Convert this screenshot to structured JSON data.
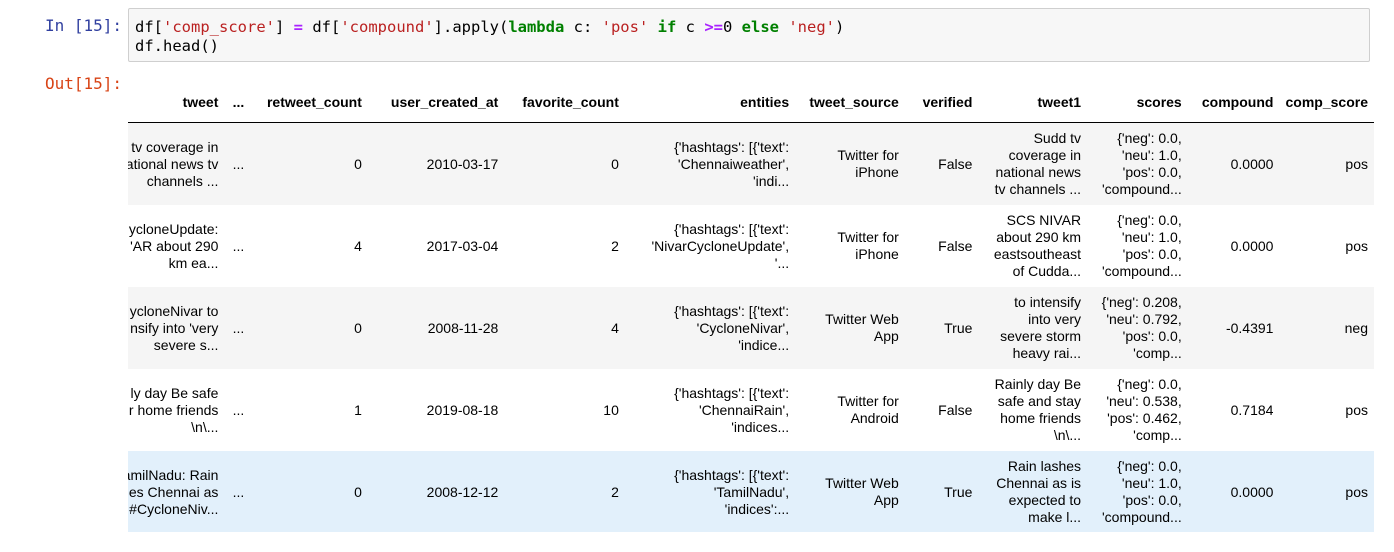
{
  "input": {
    "prompt": "In [15]:",
    "line1": [
      {
        "t": "df[",
        "c": ""
      },
      {
        "t": "'comp_score'",
        "c": "s"
      },
      {
        "t": "] ",
        "c": ""
      },
      {
        "t": "=",
        "c": "op"
      },
      {
        "t": " df[",
        "c": ""
      },
      {
        "t": "'compound'",
        "c": "s"
      },
      {
        "t": "].apply(",
        "c": ""
      },
      {
        "t": "lambda",
        "c": "kw"
      },
      {
        "t": " c: ",
        "c": ""
      },
      {
        "t": "'pos'",
        "c": "s"
      },
      {
        "t": " ",
        "c": ""
      },
      {
        "t": "if",
        "c": "kw"
      },
      {
        "t": " c ",
        "c": ""
      },
      {
        "t": ">=",
        "c": "op"
      },
      {
        "t": "0 ",
        "c": ""
      },
      {
        "t": "else",
        "c": "kw"
      },
      {
        "t": " ",
        "c": ""
      },
      {
        "t": "'neg'",
        "c": "s"
      },
      {
        "t": ")",
        "c": ""
      }
    ],
    "line2": "df.head()"
  },
  "output": {
    "prompt": "Out[15]:",
    "columns": [
      "tweet",
      "...",
      "retweet_count",
      "user_created_at",
      "favorite_count",
      "entities",
      "tweet_source",
      "verified",
      "tweet1",
      "scores",
      "compound",
      "comp_score"
    ],
    "rows": [
      {
        "tweet": [
          "tv coverage in",
          "ational news tv",
          "channels ..."
        ],
        "ellipsis": "...",
        "retweet_count": "0",
        "user_created_at": "2010-03-17",
        "favorite_count": "0",
        "entities": [
          "{'hashtags': [{'text':",
          "'Chennaiweather',",
          "'indi..."
        ],
        "tweet_source": [
          "Twitter for",
          "iPhone"
        ],
        "verified": "False",
        "tweet1": [
          "Sudd tv",
          "coverage in",
          "national news",
          "tv channels ..."
        ],
        "scores": [
          "{'neg': 0.0,",
          "'neu': 1.0,",
          "'pos': 0.0,",
          "'compound..."
        ],
        "compound": "0.0000",
        "comp_score": "pos"
      },
      {
        "tweet": [
          "ycloneUpdate:",
          "'AR about 290",
          "km ea..."
        ],
        "ellipsis": "...",
        "retweet_count": "4",
        "user_created_at": "2017-03-04",
        "favorite_count": "2",
        "entities": [
          "{'hashtags': [{'text':",
          "'NivarCycloneUpdate',",
          "'..."
        ],
        "tweet_source": [
          "Twitter for",
          "iPhone"
        ],
        "verified": "False",
        "tweet1": [
          "SCS NIVAR",
          "about 290 km",
          "eastsoutheast",
          "of Cudda..."
        ],
        "scores": [
          "{'neg': 0.0,",
          "'neu': 1.0,",
          "'pos': 0.0,",
          "'compound..."
        ],
        "compound": "0.0000",
        "comp_score": "pos"
      },
      {
        "tweet": [
          "ycloneNivar to",
          "nsify into 'very",
          "severe s..."
        ],
        "ellipsis": "...",
        "retweet_count": "0",
        "user_created_at": "2008-11-28",
        "favorite_count": "4",
        "entities": [
          "{'hashtags': [{'text':",
          "'CycloneNivar',",
          "'indice..."
        ],
        "tweet_source": [
          "Twitter Web",
          "App"
        ],
        "verified": "True",
        "tweet1": [
          "to intensify",
          "into very",
          "severe storm",
          "heavy rai..."
        ],
        "scores": [
          "{'neg': 0.208,",
          "'neu': 0.792,",
          "'pos': 0.0,",
          "'comp..."
        ],
        "compound": "-0.4391",
        "comp_score": "neg"
      },
      {
        "tweet": [
          "ly day Be safe",
          "r home friends",
          "\\n\\..."
        ],
        "ellipsis": "...",
        "retweet_count": "1",
        "user_created_at": "2019-08-18",
        "favorite_count": "10",
        "entities": [
          "{'hashtags': [{'text':",
          "'ChennaiRain',",
          "'indices..."
        ],
        "tweet_source": [
          "Twitter for",
          "Android"
        ],
        "verified": "False",
        "tweet1": [
          "Rainly day Be",
          "safe and stay",
          "home friends",
          "\\n\\..."
        ],
        "scores": [
          "{'neg': 0.0,",
          "'neu': 0.538,",
          "'pos': 0.462,",
          "'comp..."
        ],
        "compound": "0.7184",
        "comp_score": "pos"
      },
      {
        "tweet": [
          "amilNadu: Rain",
          "es Chennai as",
          "#CycloneNiv..."
        ],
        "ellipsis": "...",
        "retweet_count": "0",
        "user_created_at": "2008-12-12",
        "favorite_count": "2",
        "entities": [
          "{'hashtags': [{'text':",
          "'TamilNadu',",
          "'indices':..."
        ],
        "tweet_source": [
          "Twitter Web",
          "App"
        ],
        "verified": "True",
        "tweet1": [
          "Rain lashes",
          "Chennai as is",
          "expected to",
          "make l..."
        ],
        "scores": [
          "{'neg': 0.0,",
          "'neu': 1.0,",
          "'pos': 0.0,",
          "'compound..."
        ],
        "compound": "0.0000",
        "comp_score": "pos"
      }
    ]
  },
  "colors": {
    "in_prompt": "#303f9f",
    "out_prompt": "#d84315",
    "string": "#ba2121",
    "keyword": "#008000",
    "operator": "#aa22ff",
    "row_highlight": "#e2f0fb",
    "row_stripe": "#f5f5f5"
  }
}
